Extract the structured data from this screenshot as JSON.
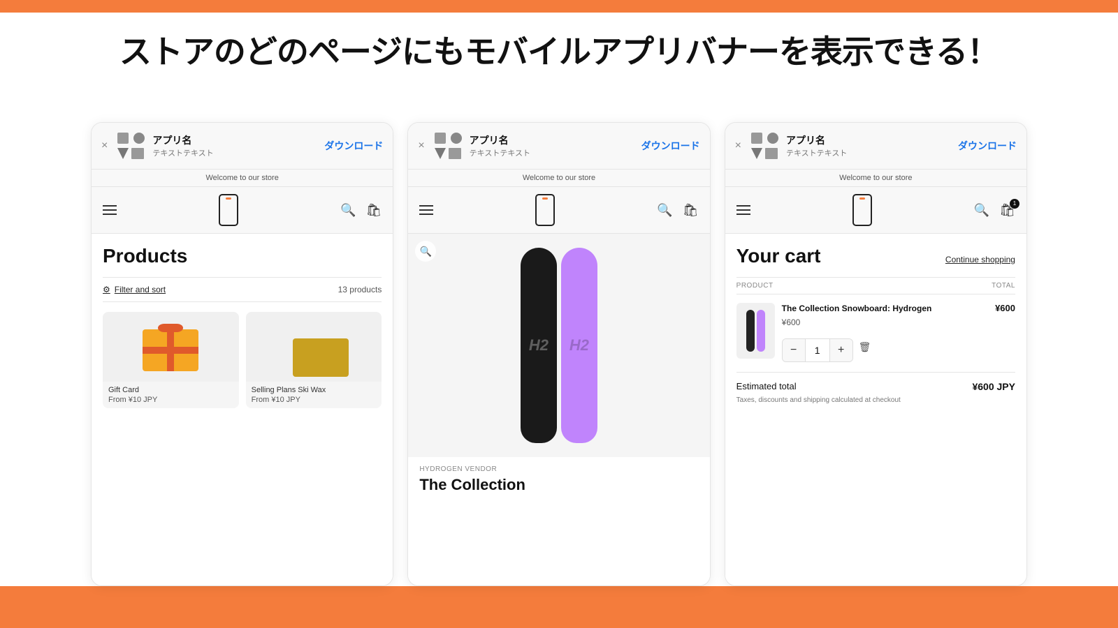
{
  "page": {
    "headline": "ストアのどのページにもモバイルアプリバナーを表示できる！"
  },
  "banner": {
    "app_name": "アプリ名",
    "app_sub": "テキストテキスト",
    "download_label": "ダウンロード",
    "close_label": "×"
  },
  "store": {
    "welcome": "Welcome to our store"
  },
  "panel1": {
    "title": "Products",
    "filter_label": "Filter and sort",
    "product_count": "13 products",
    "products": [
      {
        "name": "Gift Card",
        "price": "From ¥10 JPY"
      },
      {
        "name": "Selling Plans Ski Wax",
        "price": "From ¥10 JPY"
      }
    ]
  },
  "panel2": {
    "vendor": "HYDROGEN VENDOR",
    "product_name": "The Collection"
  },
  "panel3": {
    "title": "Your cart",
    "continue_label": "Continue shopping",
    "col_product": "PRODUCT",
    "col_total": "TOTAL",
    "item": {
      "name": "The Collection Snowboard: Hydrogen",
      "unit_price": "¥600",
      "total_price": "¥600",
      "quantity": "1"
    },
    "estimated_total_label": "Estimated total",
    "estimated_total": "¥600 JPY",
    "tax_note": "Taxes, discounts and shipping calculated at checkout"
  }
}
